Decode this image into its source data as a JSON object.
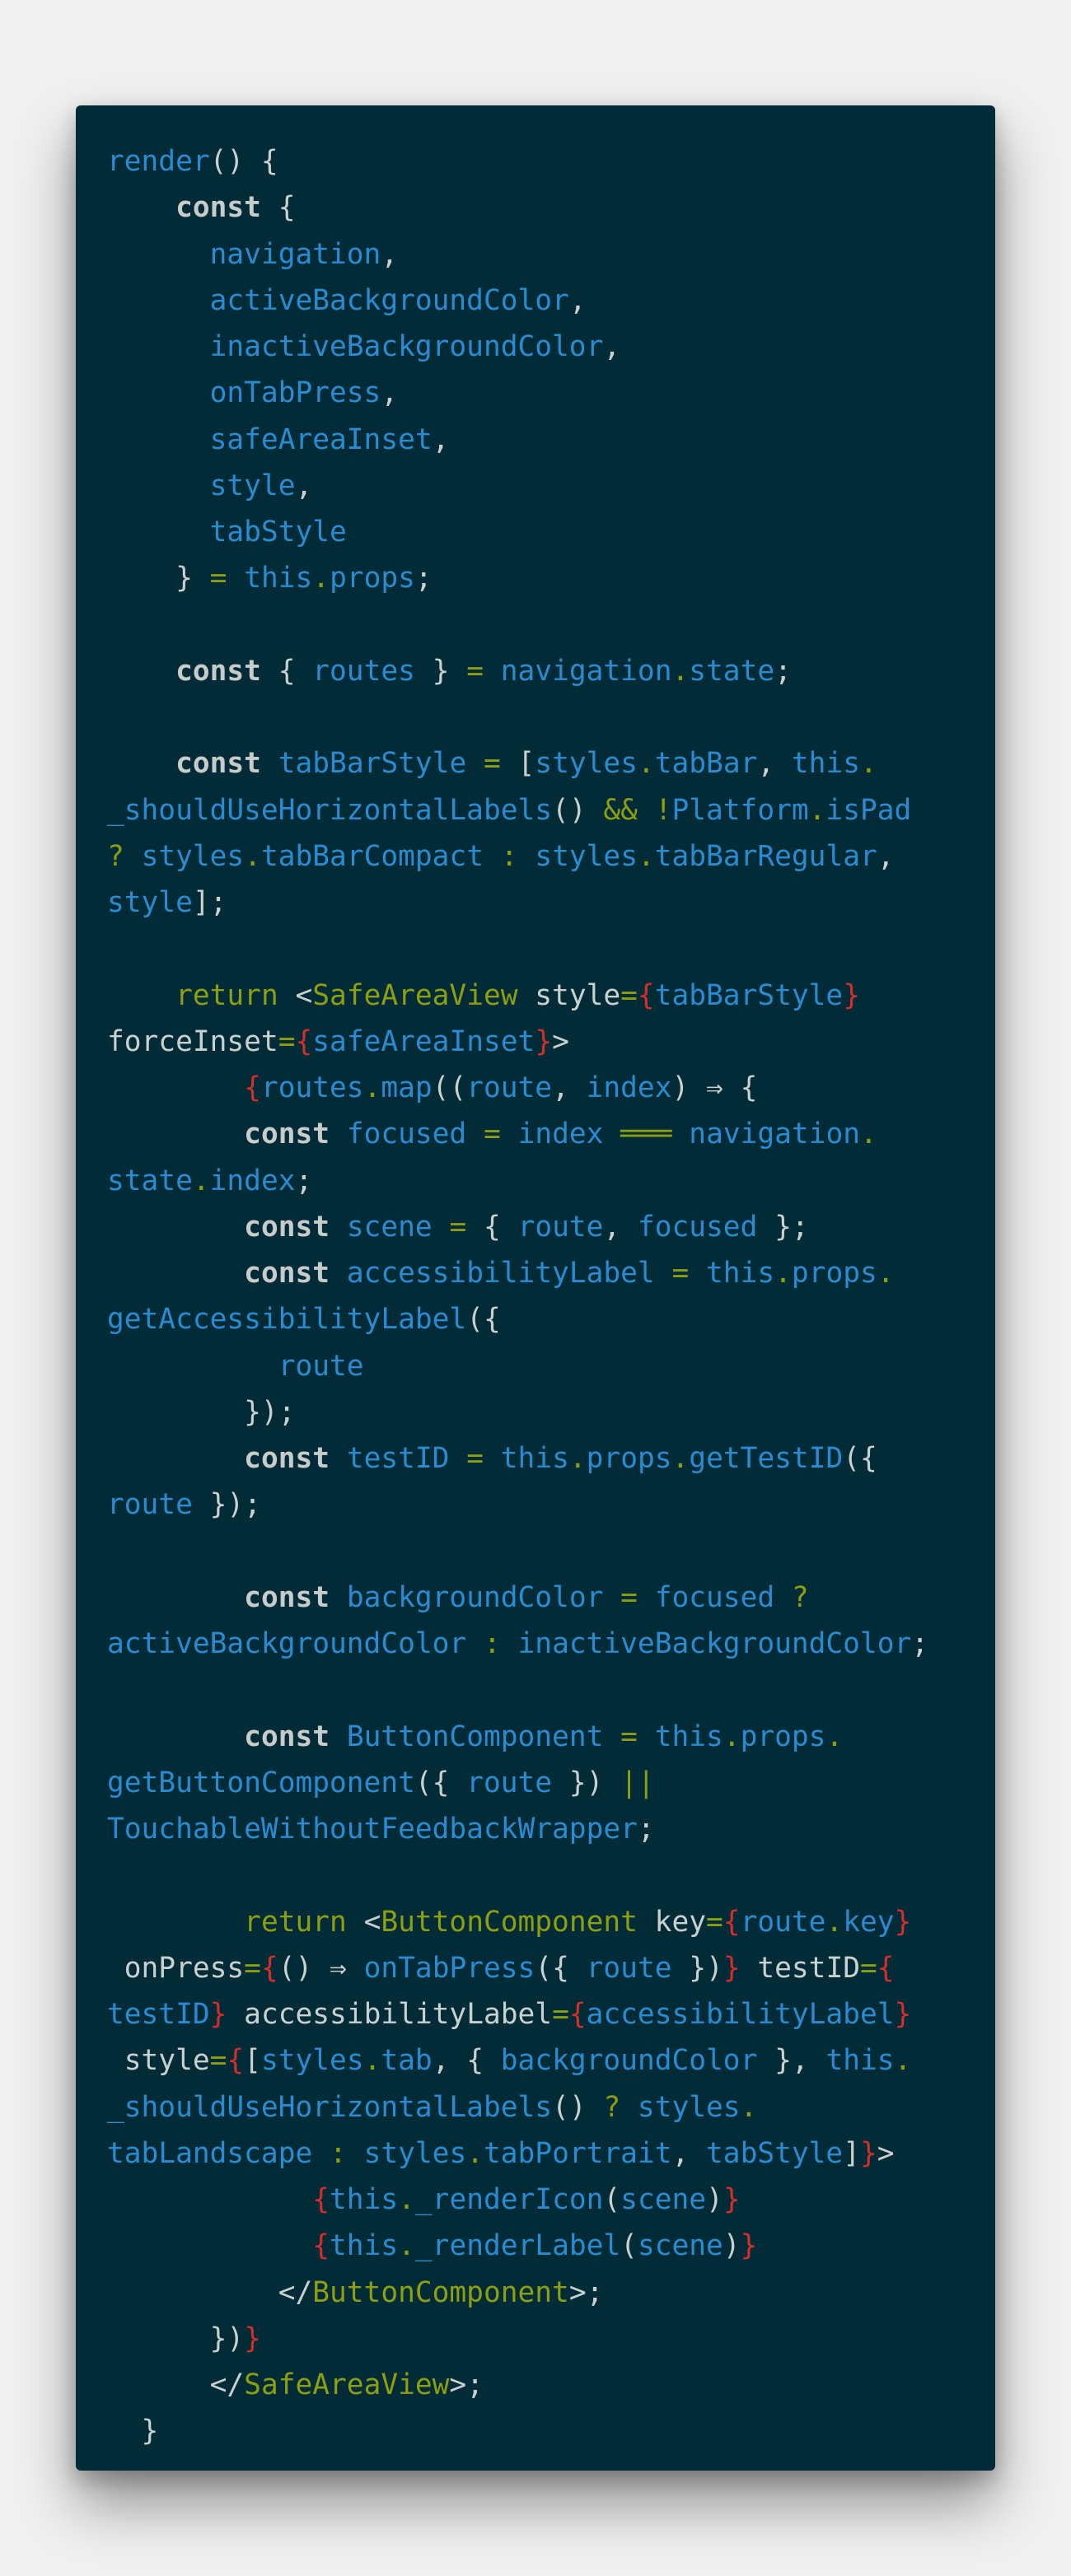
{
  "colors": {
    "page_background": "#f0f0f1",
    "code_background": "#012b36",
    "plain": "#c9d1d0",
    "keyword": "#c7cccb",
    "identifier": "#2b8bd1",
    "operator": "#8e9e12",
    "brace": "#d22f2a"
  },
  "code_lines": [
    [
      [
        "b",
        "render"
      ],
      [
        "t",
        "() {"
      ]
    ],
    [
      [
        "t",
        "    "
      ],
      [
        "k",
        "const"
      ],
      [
        "t",
        " {"
      ]
    ],
    [
      [
        "t",
        "      "
      ],
      [
        "b",
        "navigation"
      ],
      [
        "t",
        ","
      ]
    ],
    [
      [
        "t",
        "      "
      ],
      [
        "b",
        "activeBackgroundColor"
      ],
      [
        "t",
        ","
      ]
    ],
    [
      [
        "t",
        "      "
      ],
      [
        "b",
        "inactiveBackgroundColor"
      ],
      [
        "t",
        ","
      ]
    ],
    [
      [
        "t",
        "      "
      ],
      [
        "b",
        "onTabPress"
      ],
      [
        "t",
        ","
      ]
    ],
    [
      [
        "t",
        "      "
      ],
      [
        "b",
        "safeAreaInset"
      ],
      [
        "t",
        ","
      ]
    ],
    [
      [
        "t",
        "      "
      ],
      [
        "b",
        "style"
      ],
      [
        "t",
        ","
      ]
    ],
    [
      [
        "t",
        "      "
      ],
      [
        "b",
        "tabStyle"
      ]
    ],
    [
      [
        "t",
        "    } "
      ],
      [
        "y",
        "="
      ],
      [
        "t",
        " "
      ],
      [
        "b",
        "this"
      ],
      [
        "y",
        "."
      ],
      [
        "b",
        "props"
      ],
      [
        "t",
        ";"
      ]
    ],
    [],
    [
      [
        "t",
        "    "
      ],
      [
        "k",
        "const"
      ],
      [
        "t",
        " { "
      ],
      [
        "b",
        "routes"
      ],
      [
        "t",
        " } "
      ],
      [
        "y",
        "="
      ],
      [
        "t",
        " "
      ],
      [
        "b",
        "navigation"
      ],
      [
        "y",
        "."
      ],
      [
        "b",
        "state"
      ],
      [
        "t",
        ";"
      ]
    ],
    [],
    [
      [
        "t",
        "    "
      ],
      [
        "k",
        "const"
      ],
      [
        "t",
        " "
      ],
      [
        "b",
        "tabBarStyle"
      ],
      [
        "t",
        " "
      ],
      [
        "y",
        "="
      ],
      [
        "t",
        " ["
      ],
      [
        "b",
        "styles"
      ],
      [
        "y",
        "."
      ],
      [
        "b",
        "tabBar"
      ],
      [
        "t",
        ", "
      ],
      [
        "b",
        "this"
      ],
      [
        "y",
        "."
      ]
    ],
    [
      [
        "b",
        "_shouldUseHorizontalLabels"
      ],
      [
        "t",
        "() "
      ],
      [
        "y",
        "&&"
      ],
      [
        "t",
        " "
      ],
      [
        "y",
        "!"
      ],
      [
        "b",
        "Platform"
      ],
      [
        "y",
        "."
      ],
      [
        "b",
        "isPad"
      ]
    ],
    [
      [
        "y",
        "?"
      ],
      [
        "t",
        " "
      ],
      [
        "b",
        "styles"
      ],
      [
        "y",
        "."
      ],
      [
        "b",
        "tabBarCompact"
      ],
      [
        "t",
        " "
      ],
      [
        "y",
        ":"
      ],
      [
        "t",
        " "
      ],
      [
        "b",
        "styles"
      ],
      [
        "y",
        "."
      ],
      [
        "b",
        "tabBarRegular"
      ],
      [
        "t",
        ","
      ]
    ],
    [
      [
        "b",
        "style"
      ],
      [
        "t",
        "];"
      ]
    ],
    [],
    [
      [
        "t",
        "    "
      ],
      [
        "y",
        "return"
      ],
      [
        "t",
        " <"
      ],
      [
        "y",
        "SafeAreaView"
      ],
      [
        "t",
        " style"
      ],
      [
        "y",
        "="
      ],
      [
        "r",
        "{"
      ],
      [
        "b",
        "tabBarStyle"
      ],
      [
        "r",
        "}"
      ]
    ],
    [
      [
        "t",
        "forceInset"
      ],
      [
        "y",
        "="
      ],
      [
        "r",
        "{"
      ],
      [
        "b",
        "safeAreaInset"
      ],
      [
        "r",
        "}"
      ],
      [
        "t",
        ">"
      ]
    ],
    [
      [
        "t",
        "        "
      ],
      [
        "r",
        "{"
      ],
      [
        "b",
        "routes"
      ],
      [
        "y",
        "."
      ],
      [
        "b",
        "map"
      ],
      [
        "t",
        "(("
      ],
      [
        "b",
        "route"
      ],
      [
        "t",
        ", "
      ],
      [
        "b",
        "index"
      ],
      [
        "t",
        ") "
      ],
      [
        "t",
        "⇒"
      ],
      [
        "t",
        " {"
      ]
    ],
    [
      [
        "t",
        "        "
      ],
      [
        "k",
        "const"
      ],
      [
        "t",
        " "
      ],
      [
        "b",
        "focused"
      ],
      [
        "t",
        " "
      ],
      [
        "y",
        "="
      ],
      [
        "t",
        " "
      ],
      [
        "b",
        "index"
      ],
      [
        "t",
        " "
      ],
      [
        "y",
        "═══"
      ],
      [
        "t",
        " "
      ],
      [
        "b",
        "navigation"
      ],
      [
        "y",
        "."
      ]
    ],
    [
      [
        "b",
        "state"
      ],
      [
        "y",
        "."
      ],
      [
        "b",
        "index"
      ],
      [
        "t",
        ";"
      ]
    ],
    [
      [
        "t",
        "        "
      ],
      [
        "k",
        "const"
      ],
      [
        "t",
        " "
      ],
      [
        "b",
        "scene"
      ],
      [
        "t",
        " "
      ],
      [
        "y",
        "="
      ],
      [
        "t",
        " { "
      ],
      [
        "b",
        "route"
      ],
      [
        "t",
        ", "
      ],
      [
        "b",
        "focused"
      ],
      [
        "t",
        " };"
      ]
    ],
    [
      [
        "t",
        "        "
      ],
      [
        "k",
        "const"
      ],
      [
        "t",
        " "
      ],
      [
        "b",
        "accessibilityLabel"
      ],
      [
        "t",
        " "
      ],
      [
        "y",
        "="
      ],
      [
        "t",
        " "
      ],
      [
        "b",
        "this"
      ],
      [
        "y",
        "."
      ],
      [
        "b",
        "props"
      ],
      [
        "y",
        "."
      ]
    ],
    [
      [
        "b",
        "getAccessibilityLabel"
      ],
      [
        "t",
        "({"
      ]
    ],
    [
      [
        "t",
        "          "
      ],
      [
        "b",
        "route"
      ]
    ],
    [
      [
        "t",
        "        });"
      ]
    ],
    [
      [
        "t",
        "        "
      ],
      [
        "k",
        "const"
      ],
      [
        "t",
        " "
      ],
      [
        "b",
        "testID"
      ],
      [
        "t",
        " "
      ],
      [
        "y",
        "="
      ],
      [
        "t",
        " "
      ],
      [
        "b",
        "this"
      ],
      [
        "y",
        "."
      ],
      [
        "b",
        "props"
      ],
      [
        "y",
        "."
      ],
      [
        "b",
        "getTestID"
      ],
      [
        "t",
        "({"
      ]
    ],
    [
      [
        "b",
        "route"
      ],
      [
        "t",
        " });"
      ]
    ],
    [],
    [
      [
        "t",
        "        "
      ],
      [
        "k",
        "const"
      ],
      [
        "t",
        " "
      ],
      [
        "b",
        "backgroundColor"
      ],
      [
        "t",
        " "
      ],
      [
        "y",
        "="
      ],
      [
        "t",
        " "
      ],
      [
        "b",
        "focused"
      ],
      [
        "t",
        " "
      ],
      [
        "y",
        "?"
      ]
    ],
    [
      [
        "b",
        "activeBackgroundColor"
      ],
      [
        "t",
        " "
      ],
      [
        "y",
        ":"
      ],
      [
        "t",
        " "
      ],
      [
        "b",
        "inactiveBackgroundColor"
      ],
      [
        "t",
        ";"
      ]
    ],
    [],
    [
      [
        "t",
        "        "
      ],
      [
        "k",
        "const"
      ],
      [
        "t",
        " "
      ],
      [
        "b",
        "ButtonComponent"
      ],
      [
        "t",
        " "
      ],
      [
        "y",
        "="
      ],
      [
        "t",
        " "
      ],
      [
        "b",
        "this"
      ],
      [
        "y",
        "."
      ],
      [
        "b",
        "props"
      ],
      [
        "y",
        "."
      ]
    ],
    [
      [
        "b",
        "getButtonComponent"
      ],
      [
        "t",
        "({ "
      ],
      [
        "b",
        "route"
      ],
      [
        "t",
        " }) "
      ],
      [
        "y",
        "||"
      ]
    ],
    [
      [
        "b",
        "TouchableWithoutFeedbackWrapper"
      ],
      [
        "t",
        ";"
      ]
    ],
    [],
    [
      [
        "t",
        "        "
      ],
      [
        "y",
        "return"
      ],
      [
        "t",
        " <"
      ],
      [
        "y",
        "ButtonComponent"
      ],
      [
        "t",
        " key"
      ],
      [
        "y",
        "="
      ],
      [
        "r",
        "{"
      ],
      [
        "b",
        "route"
      ],
      [
        "y",
        "."
      ],
      [
        "b",
        "key"
      ],
      [
        "r",
        "}"
      ]
    ],
    [
      [
        "t",
        " onPress"
      ],
      [
        "y",
        "="
      ],
      [
        "r",
        "{"
      ],
      [
        "t",
        "() "
      ],
      [
        "t",
        "⇒"
      ],
      [
        "t",
        " "
      ],
      [
        "b",
        "onTabPress"
      ],
      [
        "t",
        "({ "
      ],
      [
        "b",
        "route"
      ],
      [
        "t",
        " })"
      ],
      [
        "r",
        "}"
      ],
      [
        "t",
        " testID"
      ],
      [
        "y",
        "="
      ],
      [
        "r",
        "{"
      ]
    ],
    [
      [
        "b",
        "testID"
      ],
      [
        "r",
        "}"
      ],
      [
        "t",
        " accessibilityLabel"
      ],
      [
        "y",
        "="
      ],
      [
        "r",
        "{"
      ],
      [
        "b",
        "accessibilityLabel"
      ],
      [
        "r",
        "}"
      ]
    ],
    [
      [
        "t",
        " style"
      ],
      [
        "y",
        "="
      ],
      [
        "r",
        "{"
      ],
      [
        "t",
        "["
      ],
      [
        "b",
        "styles"
      ],
      [
        "y",
        "."
      ],
      [
        "b",
        "tab"
      ],
      [
        "t",
        ", { "
      ],
      [
        "b",
        "backgroundColor"
      ],
      [
        "t",
        " }, "
      ],
      [
        "b",
        "this"
      ],
      [
        "y",
        "."
      ]
    ],
    [
      [
        "b",
        "_shouldUseHorizontalLabels"
      ],
      [
        "t",
        "() "
      ],
      [
        "y",
        "?"
      ],
      [
        "t",
        " "
      ],
      [
        "b",
        "styles"
      ],
      [
        "y",
        "."
      ]
    ],
    [
      [
        "b",
        "tabLandscape"
      ],
      [
        "t",
        " "
      ],
      [
        "y",
        ":"
      ],
      [
        "t",
        " "
      ],
      [
        "b",
        "styles"
      ],
      [
        "y",
        "."
      ],
      [
        "b",
        "tabPortrait"
      ],
      [
        "t",
        ", "
      ],
      [
        "b",
        "tabStyle"
      ],
      [
        "t",
        "]"
      ],
      [
        "r",
        "}"
      ],
      [
        "t",
        ">"
      ]
    ],
    [
      [
        "t",
        "            "
      ],
      [
        "r",
        "{"
      ],
      [
        "b",
        "this"
      ],
      [
        "y",
        "."
      ],
      [
        "b",
        "_renderIcon"
      ],
      [
        "t",
        "("
      ],
      [
        "b",
        "scene"
      ],
      [
        "t",
        ")"
      ],
      [
        "r",
        "}"
      ]
    ],
    [
      [
        "t",
        "            "
      ],
      [
        "r",
        "{"
      ],
      [
        "b",
        "this"
      ],
      [
        "y",
        "."
      ],
      [
        "b",
        "_renderLabel"
      ],
      [
        "t",
        "("
      ],
      [
        "b",
        "scene"
      ],
      [
        "t",
        ")"
      ],
      [
        "r",
        "}"
      ]
    ],
    [
      [
        "t",
        "          </"
      ],
      [
        "y",
        "ButtonComponent"
      ],
      [
        "t",
        ">;"
      ]
    ],
    [
      [
        "t",
        "      })"
      ],
      [
        "r",
        "}"
      ]
    ],
    [
      [
        "t",
        "      </"
      ],
      [
        "y",
        "SafeAreaView"
      ],
      [
        "t",
        ">;"
      ]
    ],
    [
      [
        "t",
        "  }"
      ]
    ]
  ]
}
